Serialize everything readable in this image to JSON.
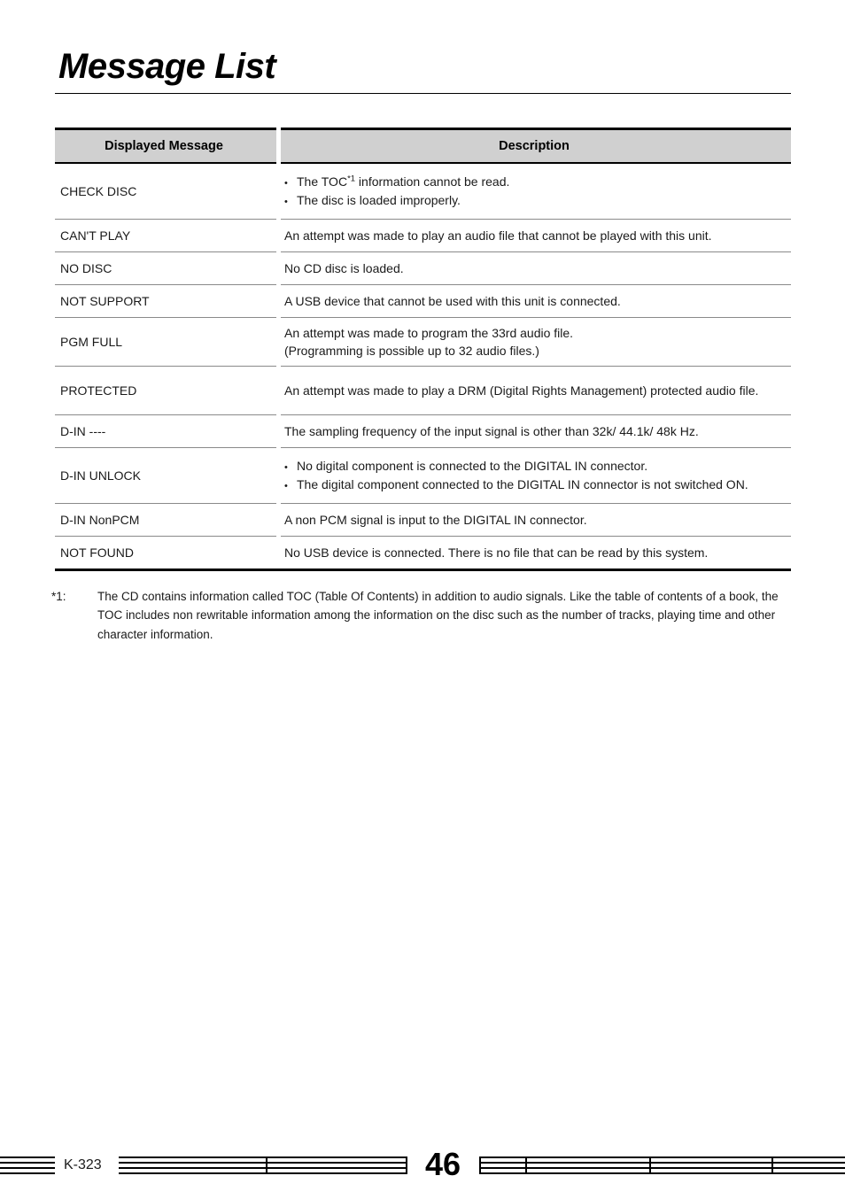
{
  "document": {
    "title": "Message List"
  },
  "table": {
    "headers": {
      "message": "Displayed Message",
      "description": "Description"
    },
    "rows": [
      {
        "message": "CHECK DISC",
        "bullets": [
          {
            "pre": "The TOC",
            "sup": "*1",
            "post": " information cannot be read."
          },
          {
            "pre": "The disc is loaded improperly.",
            "sup": "",
            "post": ""
          }
        ],
        "lines": []
      },
      {
        "message": "CAN'T PLAY",
        "bullets": [],
        "lines": [
          "An attempt was made to play an audio file that cannot be played with this unit."
        ]
      },
      {
        "message": "NO DISC",
        "bullets": [],
        "lines": [
          "No CD disc is loaded."
        ]
      },
      {
        "message": "NOT SUPPORT",
        "bullets": [],
        "lines": [
          "A USB device that cannot be used with this unit is connected."
        ]
      },
      {
        "message": "PGM FULL",
        "bullets": [],
        "lines": [
          "An attempt was made to program the 33rd audio file.",
          "(Programming is possible up to 32 audio files.)"
        ]
      },
      {
        "message": "PROTECTED",
        "bullets": [],
        "lines": [
          "An attempt was made to play a DRM (Digital Rights Management) protected audio file."
        ]
      },
      {
        "message": "D-IN ----",
        "bullets": [],
        "lines": [
          "The sampling frequency of the input signal is other than 32k/ 44.1k/ 48k Hz."
        ]
      },
      {
        "message": "D-IN UNLOCK",
        "bullets": [
          {
            "pre": "No digital component is connected to the DIGITAL IN connector.",
            "sup": "",
            "post": ""
          },
          {
            "pre": "The digital component connected to the DIGITAL IN connector is not switched ON.",
            "sup": "",
            "post": ""
          }
        ],
        "lines": []
      },
      {
        "message": "D-IN NonPCM",
        "bullets": [],
        "lines": [
          "A non PCM signal is input to the DIGITAL IN connector."
        ]
      },
      {
        "message": "NOT FOUND",
        "bullets": [],
        "lines": [
          "No USB device is connected. There is no file that can be read by this system."
        ]
      }
    ]
  },
  "footnote": {
    "marker": "*1:",
    "text": "The CD contains information called TOC (Table Of Contents) in addition to audio signals. Like the table of contents of a book, the TOC includes non rewritable information among the information on the disc such as the number of tracks, playing time and other character information."
  },
  "footer": {
    "model_code": "K-323",
    "page_number": "46"
  },
  "bullet_glyph": "•"
}
